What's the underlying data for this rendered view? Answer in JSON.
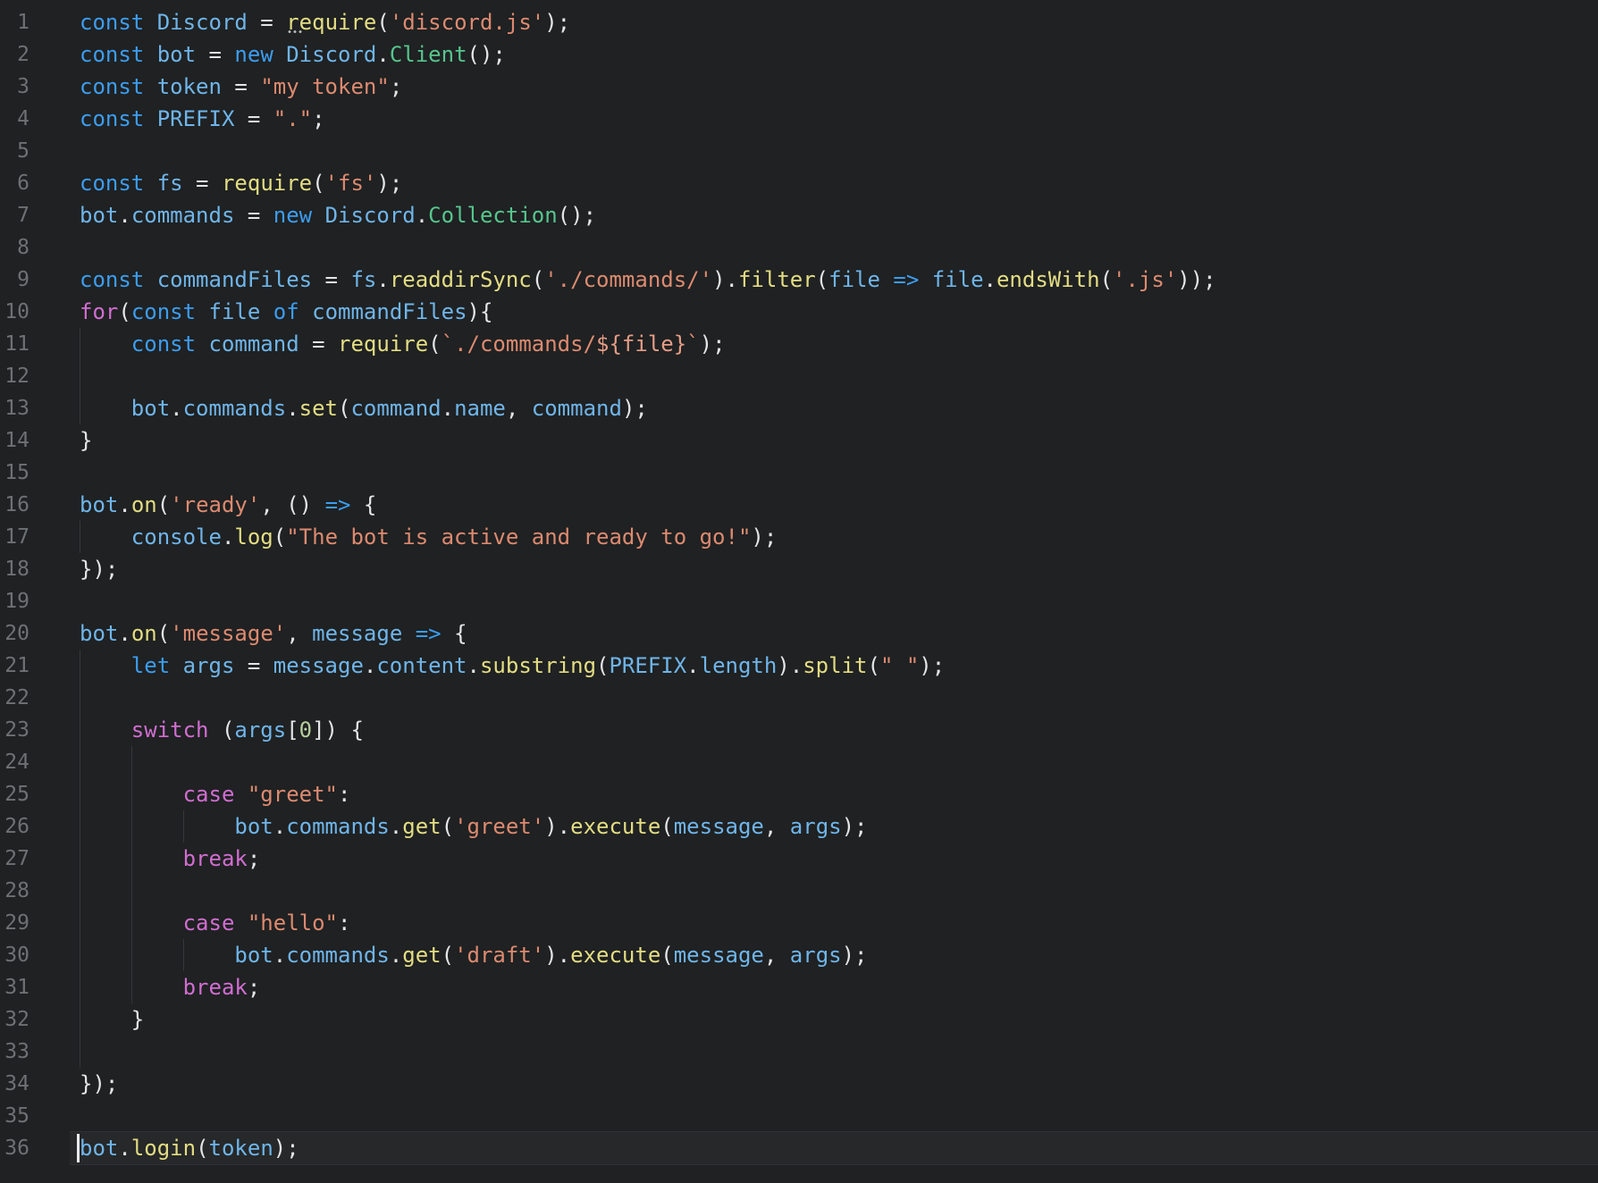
{
  "editor": {
    "language": "javascript",
    "cursor_line": 36,
    "total_lines": 36,
    "colors": {
      "background": "#1f2122",
      "gutter": "#6d7174",
      "indent_guide": "#35383b",
      "current_line_bg": "rgba(255,255,255,0.035)",
      "current_line_border": "#2e3133",
      "cursor": "#e9ebec",
      "dots": "#b9bbbc",
      "kw": "#3c9df0",
      "ctl": "#d16dd1",
      "var": "#6fb5ea",
      "fn": "#e3dd83",
      "str": "#dd8a70",
      "stri": "#e59d86",
      "cls": "#56c68e",
      "num": "#b6ce9e",
      "pun": "#e3e5e7",
      "pln": "#dcdee0"
    },
    "lines": [
      {
        "n": 1,
        "guides": [],
        "tokens": [
          [
            "kw",
            "const "
          ],
          [
            "var",
            "Discord"
          ],
          [
            "pun",
            " = "
          ],
          [
            "fn",
            "require",
            "hint"
          ],
          [
            "pun",
            "("
          ],
          [
            "str",
            "'discord.js'"
          ],
          [
            "pun",
            ");"
          ]
        ]
      },
      {
        "n": 2,
        "guides": [],
        "tokens": [
          [
            "kw",
            "const "
          ],
          [
            "var",
            "bot"
          ],
          [
            "pun",
            " = "
          ],
          [
            "kw",
            "new "
          ],
          [
            "var",
            "Discord"
          ],
          [
            "pun",
            "."
          ],
          [
            "cls",
            "Client"
          ],
          [
            "pun",
            "();"
          ]
        ]
      },
      {
        "n": 3,
        "guides": [],
        "tokens": [
          [
            "kw",
            "const "
          ],
          [
            "var",
            "token"
          ],
          [
            "pun",
            " = "
          ],
          [
            "str",
            "\"my token\""
          ],
          [
            "pun",
            ";"
          ]
        ]
      },
      {
        "n": 4,
        "guides": [],
        "tokens": [
          [
            "kw",
            "const "
          ],
          [
            "var",
            "PREFIX"
          ],
          [
            "pun",
            " = "
          ],
          [
            "str",
            "\".\""
          ],
          [
            "pun",
            ";"
          ]
        ]
      },
      {
        "n": 5,
        "guides": [],
        "tokens": []
      },
      {
        "n": 6,
        "guides": [],
        "tokens": [
          [
            "kw",
            "const "
          ],
          [
            "var",
            "fs"
          ],
          [
            "pun",
            " = "
          ],
          [
            "fn",
            "require"
          ],
          [
            "pun",
            "("
          ],
          [
            "str",
            "'fs'"
          ],
          [
            "pun",
            ");"
          ]
        ]
      },
      {
        "n": 7,
        "guides": [],
        "tokens": [
          [
            "var",
            "bot"
          ],
          [
            "pun",
            "."
          ],
          [
            "var",
            "commands"
          ],
          [
            "pun",
            " = "
          ],
          [
            "kw",
            "new "
          ],
          [
            "var",
            "Discord"
          ],
          [
            "pun",
            "."
          ],
          [
            "cls",
            "Collection"
          ],
          [
            "pun",
            "();"
          ]
        ]
      },
      {
        "n": 8,
        "guides": [],
        "tokens": []
      },
      {
        "n": 9,
        "guides": [],
        "tokens": [
          [
            "kw",
            "const "
          ],
          [
            "var",
            "commandFiles"
          ],
          [
            "pun",
            " = "
          ],
          [
            "var",
            "fs"
          ],
          [
            "pun",
            "."
          ],
          [
            "fn",
            "readdirSync"
          ],
          [
            "pun",
            "("
          ],
          [
            "str",
            "'./commands/'"
          ],
          [
            "pun",
            ")."
          ],
          [
            "fn",
            "filter"
          ],
          [
            "pun",
            "("
          ],
          [
            "var",
            "file"
          ],
          [
            "pln",
            " "
          ],
          [
            "kw",
            "=>"
          ],
          [
            "pln",
            " "
          ],
          [
            "var",
            "file"
          ],
          [
            "pun",
            "."
          ],
          [
            "fn",
            "endsWith"
          ],
          [
            "pun",
            "("
          ],
          [
            "str",
            "'.js'"
          ],
          [
            "pun",
            "));"
          ]
        ]
      },
      {
        "n": 10,
        "guides": [],
        "tokens": [
          [
            "ctl",
            "for"
          ],
          [
            "pun",
            "("
          ],
          [
            "kw",
            "const "
          ],
          [
            "var",
            "file"
          ],
          [
            "pln",
            " "
          ],
          [
            "kw",
            "of"
          ],
          [
            "pln",
            " "
          ],
          [
            "var",
            "commandFiles"
          ],
          [
            "pun",
            "){"
          ]
        ]
      },
      {
        "n": 11,
        "guides": [
          0
        ],
        "tokens": [
          [
            "pln",
            "    "
          ],
          [
            "kw",
            "const "
          ],
          [
            "var",
            "command"
          ],
          [
            "pun",
            " = "
          ],
          [
            "fn",
            "require"
          ],
          [
            "pun",
            "("
          ],
          [
            "str",
            "`./commands/"
          ],
          [
            "stri",
            "${file}"
          ],
          [
            "str",
            "`"
          ],
          [
            "pun",
            ");"
          ]
        ]
      },
      {
        "n": 12,
        "guides": [
          0
        ],
        "tokens": []
      },
      {
        "n": 13,
        "guides": [
          0
        ],
        "tokens": [
          [
            "pln",
            "    "
          ],
          [
            "var",
            "bot"
          ],
          [
            "pun",
            "."
          ],
          [
            "var",
            "commands"
          ],
          [
            "pun",
            "."
          ],
          [
            "fn",
            "set"
          ],
          [
            "pun",
            "("
          ],
          [
            "var",
            "command"
          ],
          [
            "pun",
            "."
          ],
          [
            "var",
            "name"
          ],
          [
            "pun",
            ", "
          ],
          [
            "var",
            "command"
          ],
          [
            "pun",
            ");"
          ]
        ]
      },
      {
        "n": 14,
        "guides": [],
        "tokens": [
          [
            "pun",
            "}"
          ]
        ]
      },
      {
        "n": 15,
        "guides": [],
        "tokens": []
      },
      {
        "n": 16,
        "guides": [],
        "tokens": [
          [
            "var",
            "bot"
          ],
          [
            "pun",
            "."
          ],
          [
            "fn",
            "on"
          ],
          [
            "pun",
            "("
          ],
          [
            "str",
            "'ready'"
          ],
          [
            "pun",
            ", () "
          ],
          [
            "kw",
            "=>"
          ],
          [
            "pun",
            " {"
          ]
        ]
      },
      {
        "n": 17,
        "guides": [
          0
        ],
        "tokens": [
          [
            "pln",
            "    "
          ],
          [
            "var",
            "console"
          ],
          [
            "pun",
            "."
          ],
          [
            "fn",
            "log"
          ],
          [
            "pun",
            "("
          ],
          [
            "str",
            "\"The bot is active and ready to go!\""
          ],
          [
            "pun",
            ");"
          ]
        ]
      },
      {
        "n": 18,
        "guides": [],
        "tokens": [
          [
            "pun",
            "});"
          ]
        ]
      },
      {
        "n": 19,
        "guides": [],
        "tokens": []
      },
      {
        "n": 20,
        "guides": [],
        "tokens": [
          [
            "var",
            "bot"
          ],
          [
            "pun",
            "."
          ],
          [
            "fn",
            "on"
          ],
          [
            "pun",
            "("
          ],
          [
            "str",
            "'message'"
          ],
          [
            "pun",
            ", "
          ],
          [
            "var",
            "message"
          ],
          [
            "pln",
            " "
          ],
          [
            "kw",
            "=>"
          ],
          [
            "pun",
            " {"
          ]
        ]
      },
      {
        "n": 21,
        "guides": [
          0
        ],
        "tokens": [
          [
            "pln",
            "    "
          ],
          [
            "kw",
            "let "
          ],
          [
            "var",
            "args"
          ],
          [
            "pun",
            " = "
          ],
          [
            "var",
            "message"
          ],
          [
            "pun",
            "."
          ],
          [
            "var",
            "content"
          ],
          [
            "pun",
            "."
          ],
          [
            "fn",
            "substring"
          ],
          [
            "pun",
            "("
          ],
          [
            "var",
            "PREFIX"
          ],
          [
            "pun",
            "."
          ],
          [
            "var",
            "length"
          ],
          [
            "pun",
            ")."
          ],
          [
            "fn",
            "split"
          ],
          [
            "pun",
            "("
          ],
          [
            "str",
            "\" \""
          ],
          [
            "pun",
            ");"
          ]
        ]
      },
      {
        "n": 22,
        "guides": [
          0
        ],
        "tokens": []
      },
      {
        "n": 23,
        "guides": [
          0
        ],
        "tokens": [
          [
            "pln",
            "    "
          ],
          [
            "ctl",
            "switch"
          ],
          [
            "pun",
            " ("
          ],
          [
            "var",
            "args"
          ],
          [
            "pun",
            "["
          ],
          [
            "num",
            "0"
          ],
          [
            "pun",
            "]) {"
          ]
        ]
      },
      {
        "n": 24,
        "guides": [
          0,
          4
        ],
        "tokens": []
      },
      {
        "n": 25,
        "guides": [
          0,
          4
        ],
        "tokens": [
          [
            "pln",
            "        "
          ],
          [
            "ctl",
            "case "
          ],
          [
            "str",
            "\"greet\""
          ],
          [
            "pun",
            ":"
          ]
        ]
      },
      {
        "n": 26,
        "guides": [
          0,
          4,
          8
        ],
        "tokens": [
          [
            "pln",
            "            "
          ],
          [
            "var",
            "bot"
          ],
          [
            "pun",
            "."
          ],
          [
            "var",
            "commands"
          ],
          [
            "pun",
            "."
          ],
          [
            "fn",
            "get"
          ],
          [
            "pun",
            "("
          ],
          [
            "str",
            "'greet'"
          ],
          [
            "pun",
            ")."
          ],
          [
            "fn",
            "execute"
          ],
          [
            "pun",
            "("
          ],
          [
            "var",
            "message"
          ],
          [
            "pun",
            ", "
          ],
          [
            "var",
            "args"
          ],
          [
            "pun",
            ");"
          ]
        ]
      },
      {
        "n": 27,
        "guides": [
          0,
          4
        ],
        "tokens": [
          [
            "pln",
            "        "
          ],
          [
            "ctl",
            "break"
          ],
          [
            "pun",
            ";"
          ]
        ]
      },
      {
        "n": 28,
        "guides": [
          0,
          4
        ],
        "tokens": []
      },
      {
        "n": 29,
        "guides": [
          0,
          4
        ],
        "tokens": [
          [
            "pln",
            "        "
          ],
          [
            "ctl",
            "case "
          ],
          [
            "str",
            "\"hello\""
          ],
          [
            "pun",
            ":"
          ]
        ]
      },
      {
        "n": 30,
        "guides": [
          0,
          4,
          8
        ],
        "tokens": [
          [
            "pln",
            "            "
          ],
          [
            "var",
            "bot"
          ],
          [
            "pun",
            "."
          ],
          [
            "var",
            "commands"
          ],
          [
            "pun",
            "."
          ],
          [
            "fn",
            "get"
          ],
          [
            "pun",
            "("
          ],
          [
            "str",
            "'draft'"
          ],
          [
            "pun",
            ")."
          ],
          [
            "fn",
            "execute"
          ],
          [
            "pun",
            "("
          ],
          [
            "var",
            "message"
          ],
          [
            "pun",
            ", "
          ],
          [
            "var",
            "args"
          ],
          [
            "pun",
            ");"
          ]
        ]
      },
      {
        "n": 31,
        "guides": [
          0,
          4
        ],
        "tokens": [
          [
            "pln",
            "        "
          ],
          [
            "ctl",
            "break"
          ],
          [
            "pun",
            ";"
          ]
        ]
      },
      {
        "n": 32,
        "guides": [
          0
        ],
        "tokens": [
          [
            "pln",
            "    "
          ],
          [
            "pun",
            "}"
          ]
        ]
      },
      {
        "n": 33,
        "guides": [
          0
        ],
        "tokens": []
      },
      {
        "n": 34,
        "guides": [],
        "tokens": [
          [
            "pun",
            "});"
          ]
        ]
      },
      {
        "n": 35,
        "guides": [],
        "tokens": []
      },
      {
        "n": 36,
        "guides": [],
        "tokens": [
          [
            "var",
            "bot"
          ],
          [
            "pun",
            "."
          ],
          [
            "fn",
            "login"
          ],
          [
            "pun",
            "("
          ],
          [
            "var",
            "token"
          ],
          [
            "pun",
            ");"
          ]
        ]
      }
    ]
  }
}
